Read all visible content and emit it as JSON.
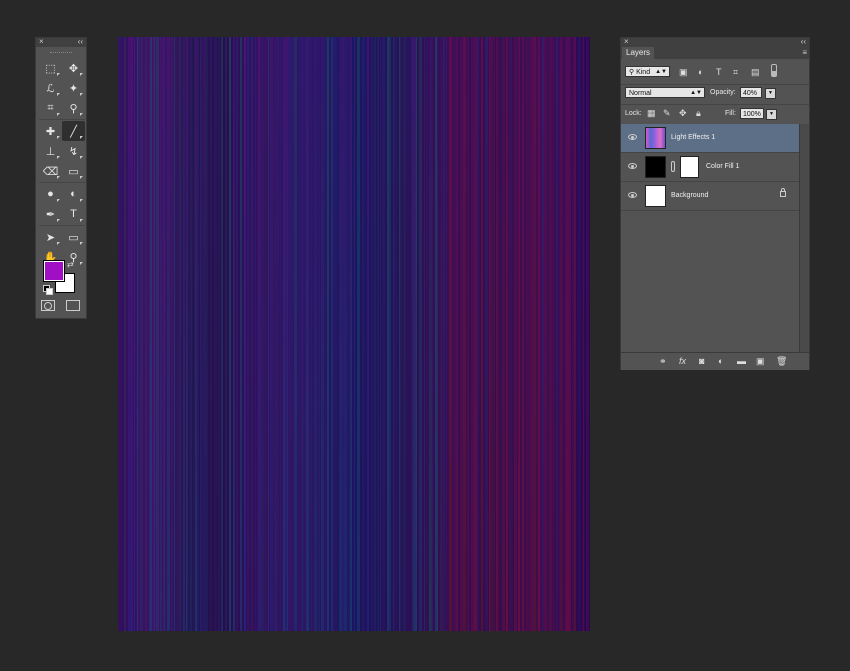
{
  "tools_panel": {
    "close_glyph": "×",
    "collapse_glyph": "‹‹",
    "foreground_color": "#a10fc4",
    "background_color": "#ffffff",
    "rows": [
      [
        {
          "name": "marquee-tool",
          "glyph": "⬚"
        },
        {
          "name": "move-tool",
          "glyph": "✥"
        }
      ],
      [
        {
          "name": "lasso-tool",
          "glyph": "ℒ"
        },
        {
          "name": "magic-wand-tool",
          "glyph": "✦"
        }
      ],
      [
        {
          "name": "crop-tool",
          "glyph": "⌗"
        },
        {
          "name": "eyedropper-tool",
          "glyph": "⚲"
        }
      ],
      [
        {
          "name": "spot-healing-brush-tool",
          "glyph": "✚"
        },
        {
          "name": "brush-tool",
          "glyph": "╱",
          "selected": true
        }
      ],
      [
        {
          "name": "clone-stamp-tool",
          "glyph": "⊥"
        },
        {
          "name": "history-brush-tool",
          "glyph": "↯"
        }
      ],
      [
        {
          "name": "eraser-tool",
          "glyph": "⌫"
        },
        {
          "name": "gradient-tool",
          "glyph": "▭"
        }
      ],
      [
        {
          "name": "blur-tool",
          "glyph": "●"
        },
        {
          "name": "dodge-tool",
          "glyph": "◐"
        }
      ],
      [
        {
          "name": "pen-tool",
          "glyph": "✒"
        },
        {
          "name": "type-tool",
          "glyph": "T"
        }
      ],
      [
        {
          "name": "path-selection-tool",
          "glyph": "➤"
        },
        {
          "name": "rectangle-tool",
          "glyph": "▭"
        }
      ],
      [
        {
          "name": "hand-tool",
          "glyph": "✋"
        },
        {
          "name": "zoom-tool",
          "glyph": "⚲"
        }
      ]
    ]
  },
  "layers_panel": {
    "close_glyph": "×",
    "collapse_glyph": "‹‹",
    "tab_label": "Layers",
    "menu_glyph": "≡",
    "filter": {
      "kind_label": "Kind"
    },
    "blend_mode": "Normal",
    "opacity_label": "Opacity:",
    "opacity_value": "40%",
    "lock_label": "Lock:",
    "fill_label": "Fill:",
    "fill_value": "100%",
    "layers": [
      {
        "name": "Light Effects 1",
        "selected": true
      },
      {
        "name": "Color Fill 1",
        "selected": false
      },
      {
        "name": "Background",
        "selected": false
      }
    ]
  },
  "colors": {
    "app_background": "#282828",
    "panel": "#535353",
    "selected_layer": "#5d6e87"
  }
}
